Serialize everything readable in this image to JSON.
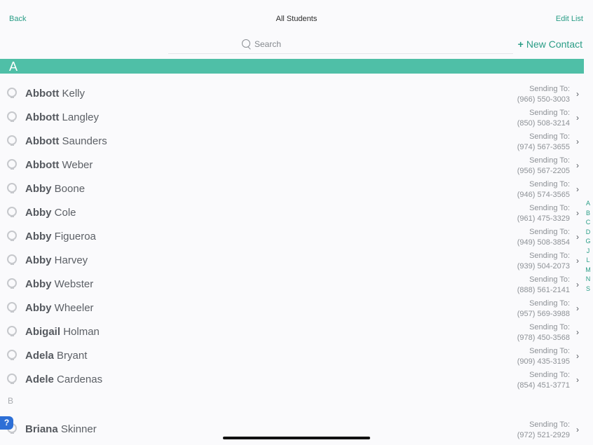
{
  "nav": {
    "back": "Back",
    "title": "All Students",
    "edit": "Edit List"
  },
  "search": {
    "placeholder": "Search"
  },
  "new_contact": {
    "plus": "+",
    "label": "New Contact"
  },
  "sections": {
    "a": "A",
    "b": "B"
  },
  "sending_label": "Sending To:",
  "contacts": [
    {
      "first": "Abbott",
      "last": "Kelly",
      "phone": "(966) 550-3003"
    },
    {
      "first": "Abbott",
      "last": "Langley",
      "phone": "(850) 508-3214"
    },
    {
      "first": "Abbott",
      "last": "Saunders",
      "phone": "(974) 567-3655"
    },
    {
      "first": "Abbott",
      "last": "Weber",
      "phone": "(956) 567-2205"
    },
    {
      "first": "Abby",
      "last": "Boone",
      "phone": "(946) 574-3565"
    },
    {
      "first": "Abby",
      "last": "Cole",
      "phone": "(961) 475-3329"
    },
    {
      "first": "Abby",
      "last": "Figueroa",
      "phone": "(949) 508-3854"
    },
    {
      "first": "Abby",
      "last": "Harvey",
      "phone": "(939) 504-2073"
    },
    {
      "first": "Abby",
      "last": "Webster",
      "phone": "(888) 561-2141"
    },
    {
      "first": "Abby",
      "last": "Wheeler",
      "phone": "(957) 569-3988"
    },
    {
      "first": "Abigail",
      "last": "Holman",
      "phone": "(978) 450-3568"
    },
    {
      "first": "Adela",
      "last": "Bryant",
      "phone": "(909) 435-3195"
    },
    {
      "first": "Adele",
      "last": "Cardenas",
      "phone": "(854) 451-3771"
    }
  ],
  "contact_b": {
    "first": "Briana",
    "last": "Skinner",
    "phone": "(972) 521-2929"
  },
  "index_letters": [
    "A",
    "B",
    "C",
    "D",
    "G",
    "J",
    "L",
    "M",
    "N",
    "S"
  ],
  "colors": {
    "accent": "#2a9d86",
    "section_bar": "#4fbfa7",
    "help_badge": "#2d6fd6"
  },
  "icons": {
    "help": "?",
    "chevron": "›"
  }
}
